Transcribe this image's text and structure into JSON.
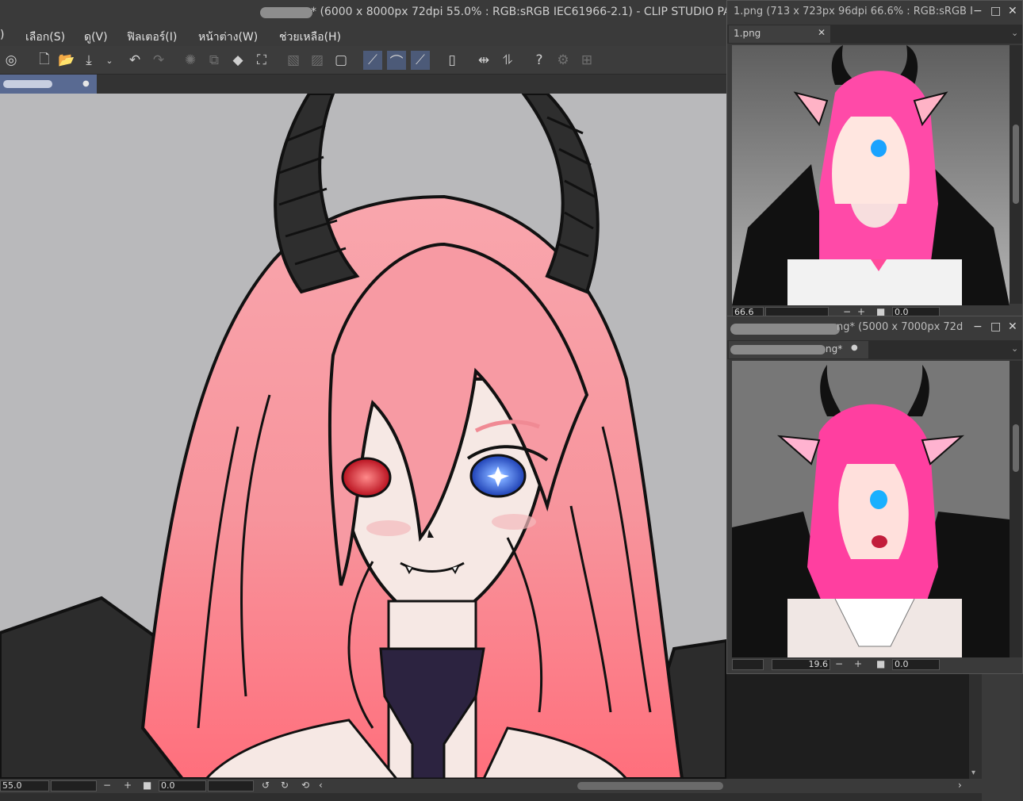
{
  "titlebar": {
    "title": "* (6000 x 8000px 72dpi 55.0% : RGB:sRGB IEC61966-2.1)  - CLIP STUDIO PAINT P"
  },
  "menu": {
    "items": [
      ")",
      "เลือก(S)",
      "ดู(V)",
      "ฟิลเตอร์(I)",
      "หน้าต่าง(W)",
      "ช่วยเหลือ(H)"
    ]
  },
  "canvas_tab": {
    "modified_marker": "●"
  },
  "statusbar": {
    "zoom": "55.0",
    "rotation": "0.0",
    "minus": "−",
    "plus": "+",
    "stop": "■"
  },
  "sub_panel_1": {
    "title": "1.png (713 x 723px 96dpi 66.6% : RGB:sRGB I",
    "tab_label": "1.png",
    "zoom": "66.6",
    "rotation": "0.0"
  },
  "sub_panel_2": {
    "title_suffix": "ng* (5000 x 7000px 72d",
    "tab_suffix": "ng*",
    "tab_marker": "●",
    "zoom": "19.6",
    "rotation": "0.0"
  },
  "window_controls": {
    "minimize": "−",
    "maximize": "□",
    "close": "✕"
  },
  "colors": {
    "hair_main": "#f79aa3",
    "hair_deep": "#ff6f7c",
    "horn": "#2c2c2c",
    "skin": "#f6e8e4",
    "collar": "#2c2340",
    "eye_left": "#d11a2a",
    "eye_right": "#2d57d6",
    "ref_hair": "#ff3fa0",
    "canvas_bg": "#b9b9bb",
    "tab_active": "#596a92"
  }
}
